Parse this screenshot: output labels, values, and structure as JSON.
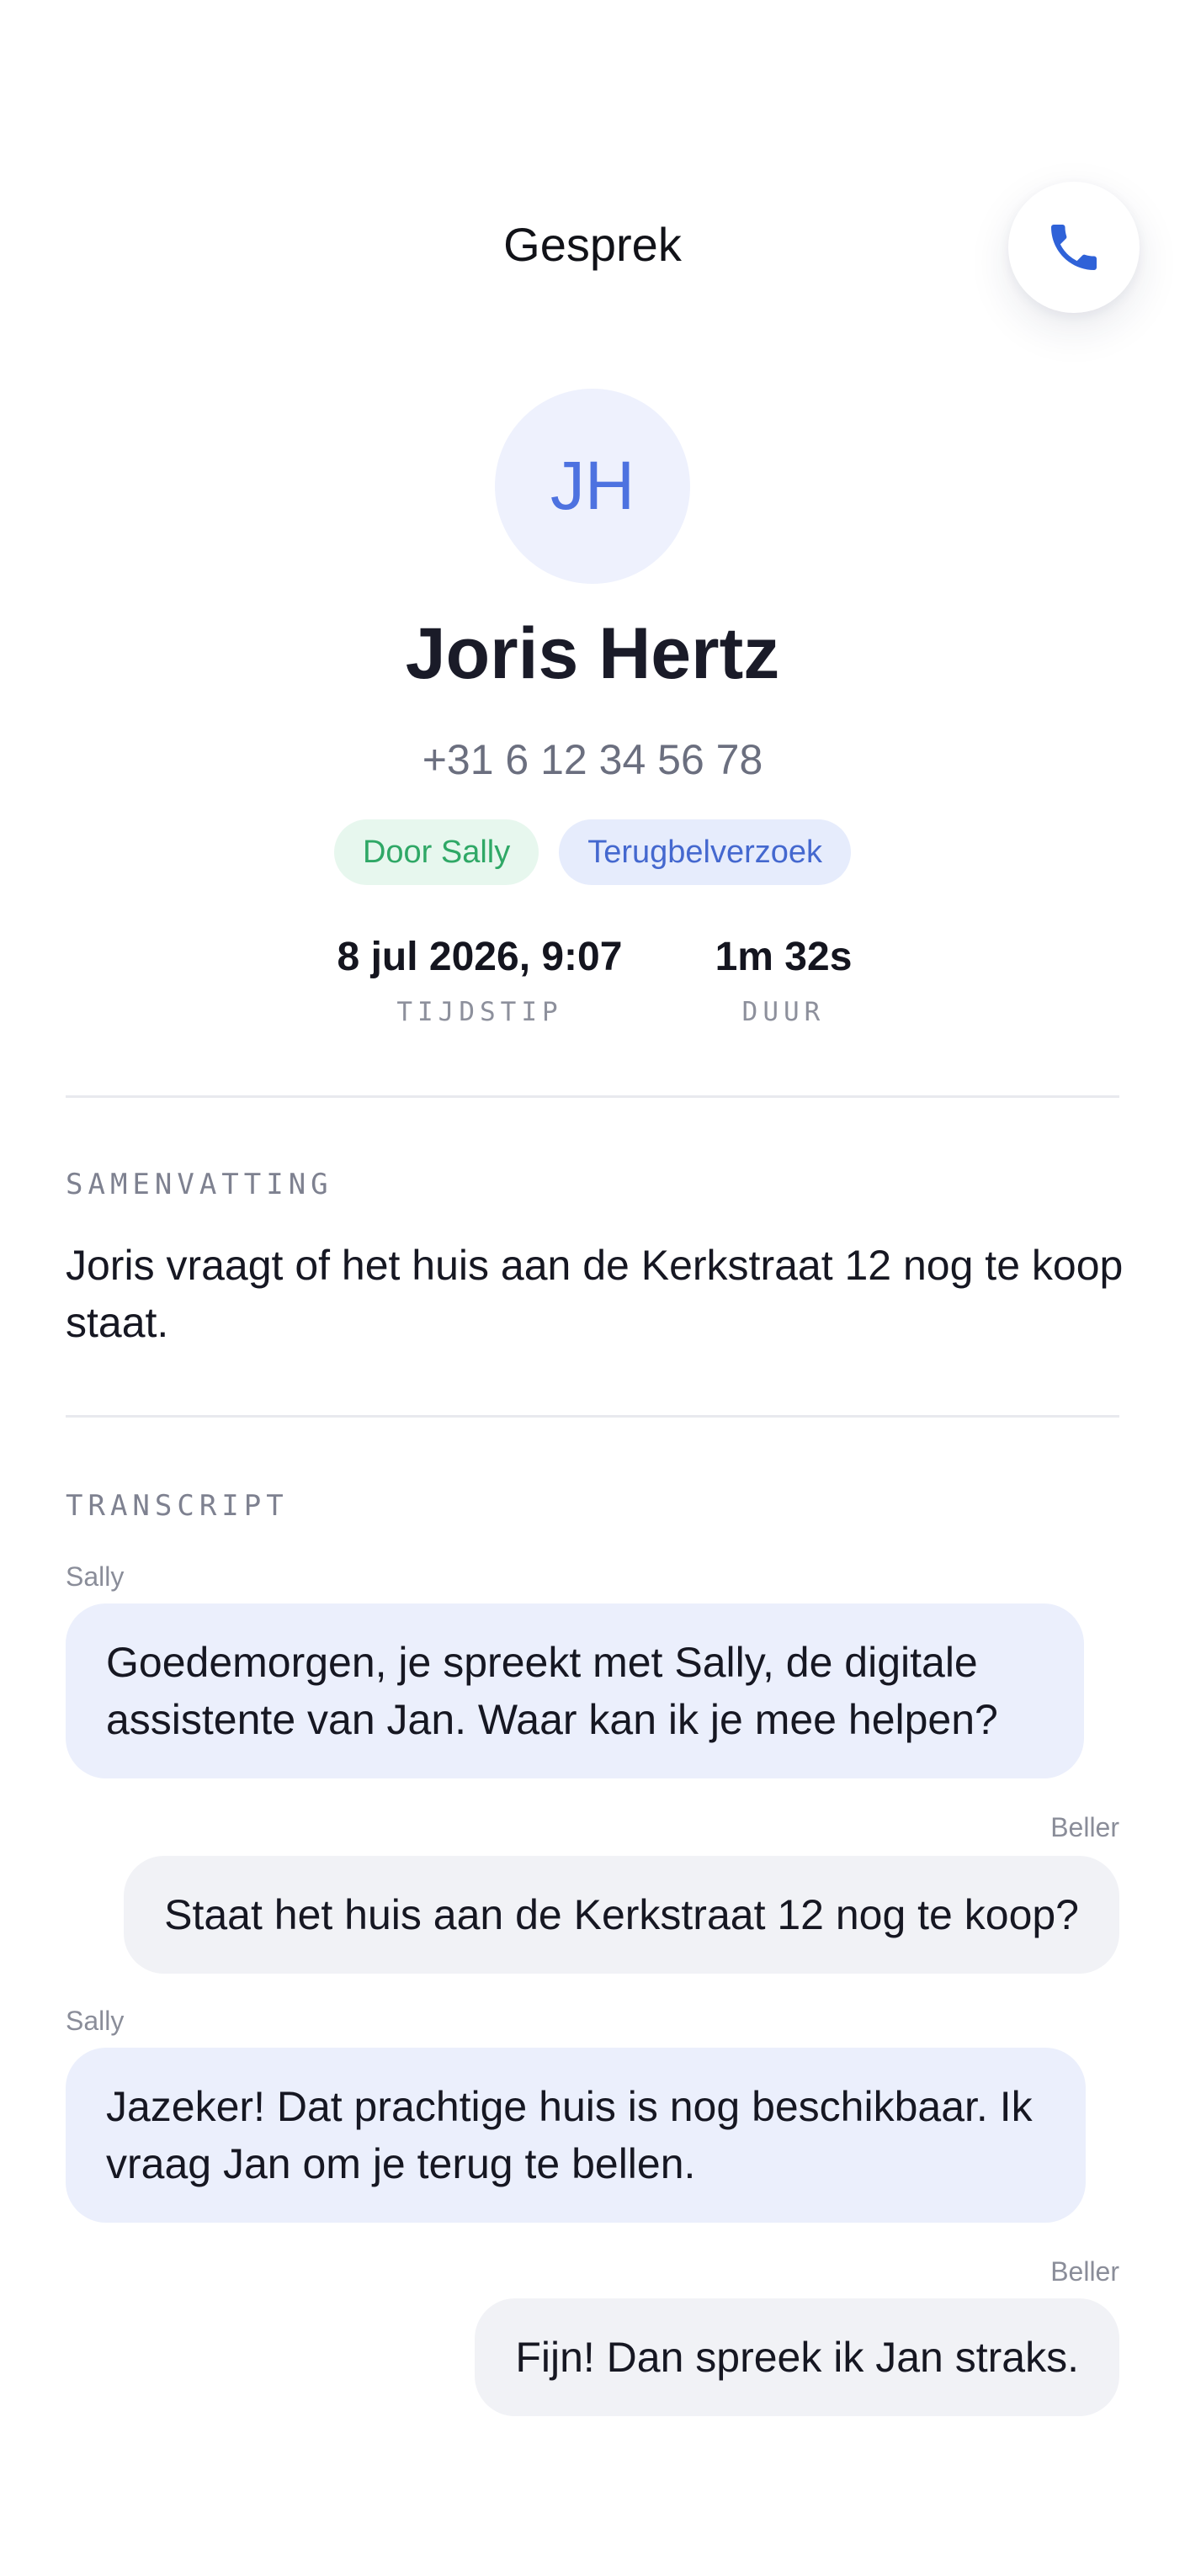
{
  "header": {
    "title": "Gesprek"
  },
  "contact": {
    "initials": "JH",
    "name": "Joris Hertz",
    "phone": "+31 6 12 34 56 78",
    "tags": [
      {
        "label": "Door Sally",
        "color": "#2fa866"
      },
      {
        "label": "Terugbelverzoek",
        "color": "#4468cf"
      }
    ]
  },
  "meta": {
    "time_value": "8 jul 2026, 9:07",
    "time_label": "TIJDSTIP",
    "duration_value": "1m 32s",
    "duration_label": "DUUR"
  },
  "summary": {
    "label": "SAMENVATTING",
    "text": "Joris vraagt of het huis aan de Kerkstraat 12 nog te koop staat."
  },
  "transcript": {
    "label": "TRANSCRIPT",
    "messages": [
      {
        "speaker": "Sally",
        "text": "Goedemorgen, je spreekt met Sally, de digitale assistente van Jan. Waar kan ik je mee helpen?"
      },
      {
        "speaker": "Beller",
        "text": "Staat het huis aan de Kerkstraat 12 nog te koop?"
      },
      {
        "speaker": "Sally",
        "text": "Jazeker! Dat prachtige huis is nog beschikbaar. Ik vraag Jan om je terug te bellen."
      },
      {
        "speaker": "Beller",
        "text": "Fijn! Dan spreek ik Jan straks."
      }
    ]
  },
  "icons": {
    "call_button": "phone-icon"
  },
  "colors": {
    "accent": "#4d72e0",
    "phone_icon": "#2f62d8",
    "sally_bubble": "#ebeffc",
    "caller_bubble": "#f1f2f6"
  }
}
